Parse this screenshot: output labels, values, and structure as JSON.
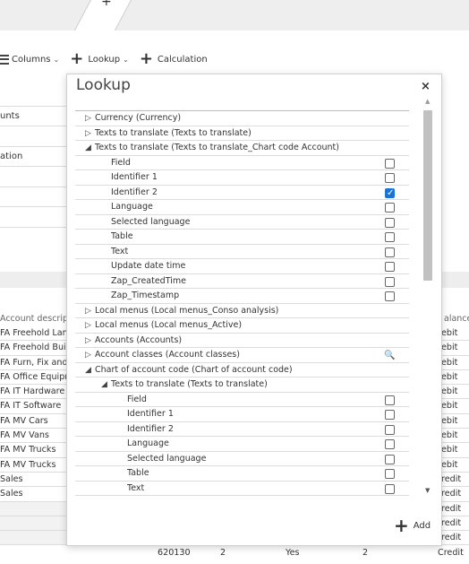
{
  "tabs": {
    "add_symbol": "+"
  },
  "toolbar": {
    "columns_label": "Columns",
    "lookup_label": "Lookup",
    "calculation_label": "Calculation"
  },
  "upper_rows": [
    "",
    "unts",
    "",
    "ation",
    "",
    "",
    ""
  ],
  "grid": {
    "account_header": "Account descrip",
    "balance_header": "alance",
    "accounts": [
      "FA Freehold Lan",
      "FA Freehold Bui",
      "FA Furn, Fix and",
      "FA Office Equipr",
      "FA IT Hardware",
      "FA IT Software",
      "FA MV Cars",
      "FA MV Vans",
      "FA MV Trucks",
      "FA MV Trucks",
      "Sales",
      "Sales",
      "",
      "",
      ""
    ],
    "balances": [
      "ebit",
      "ebit",
      "ebit",
      "ebit",
      "ebit",
      "ebit",
      "ebit",
      "ebit",
      "ebit",
      "ebit",
      "redit",
      "redit",
      "redit",
      "redit",
      "redit"
    ],
    "last_row": {
      "code": "620130",
      "n1": "2",
      "flag": "Yes",
      "n2": "2",
      "type": "Credit"
    }
  },
  "modal": {
    "title": "Lookup",
    "close_symbol": "×",
    "add_label": "Add",
    "tree": [
      {
        "label": "Currency (Currency)",
        "level": 0,
        "state": "collapsed"
      },
      {
        "label": "Texts to translate (Texts to translate)",
        "level": 0,
        "state": "collapsed"
      },
      {
        "label": "Texts to translate (Texts to translate_Chart code Account)",
        "level": 0,
        "state": "expanded"
      },
      {
        "label": "Field",
        "level": 1,
        "check": false
      },
      {
        "label": "Identifier 1",
        "level": 1,
        "check": false
      },
      {
        "label": "Identifier 2",
        "level": 1,
        "check": true
      },
      {
        "label": "Language",
        "level": 1,
        "check": false
      },
      {
        "label": "Selected language",
        "level": 1,
        "check": false
      },
      {
        "label": "Table",
        "level": 1,
        "check": false
      },
      {
        "label": "Text",
        "level": 1,
        "check": false
      },
      {
        "label": "Update date time",
        "level": 1,
        "check": false
      },
      {
        "label": "Zap_CreatedTime",
        "level": 1,
        "check": false
      },
      {
        "label": "Zap_Timestamp",
        "level": 1,
        "check": false
      },
      {
        "label": "Local menus (Local menus_Conso analysis)",
        "level": 0,
        "state": "collapsed"
      },
      {
        "label": "Local menus (Local menus_Active)",
        "level": 0,
        "state": "collapsed"
      },
      {
        "label": "Accounts (Accounts)",
        "level": 0,
        "state": "collapsed"
      },
      {
        "label": "Account classes (Account classes)",
        "level": 0,
        "state": "collapsed",
        "search": true
      },
      {
        "label": "Chart of account code (Chart of account code)",
        "level": 0,
        "state": "expanded"
      },
      {
        "label": "Texts to translate (Texts to translate)",
        "level": 1,
        "state": "expanded"
      },
      {
        "label": "Field",
        "level": 2,
        "check": false
      },
      {
        "label": "Identifier 1",
        "level": 2,
        "check": false
      },
      {
        "label": "Identifier 2",
        "level": 2,
        "check": false
      },
      {
        "label": "Language",
        "level": 2,
        "check": false
      },
      {
        "label": "Selected language",
        "level": 2,
        "check": false
      },
      {
        "label": "Table",
        "level": 2,
        "check": false
      },
      {
        "label": "Text",
        "level": 2,
        "check": false
      }
    ]
  },
  "colors": {
    "accent": "#1a73d9",
    "search_icon": "#2a7bd0"
  }
}
